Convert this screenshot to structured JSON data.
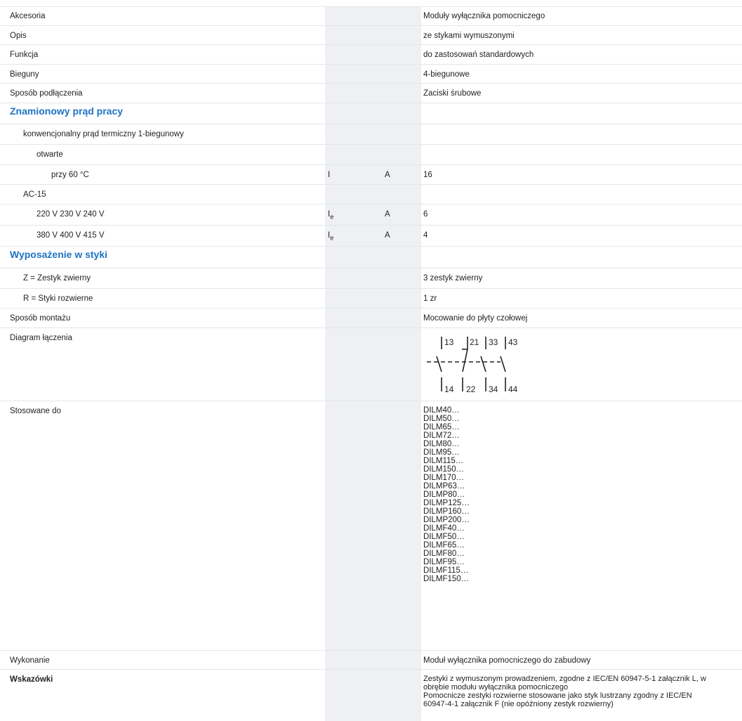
{
  "rows": [
    {
      "label": "Akcesoria",
      "value": "Moduły wyłącznika pomocniczego"
    },
    {
      "label": "Opis",
      "value": "ze stykami wymuszonymi"
    },
    {
      "label": "Funkcja",
      "value": "do zastosowań standardowych"
    },
    {
      "label": "Bieguny",
      "value": "4-biegunowe"
    },
    {
      "label": "Sposób podłączenia",
      "value": "Zaciski śrubowe"
    },
    {
      "heading": "Znamionowy prąd pracy"
    },
    {
      "label": "konwencjonalny prąd termiczny 1-biegunowy"
    },
    {
      "label": "otwarte"
    },
    {
      "label": "przy 60 °C",
      "symbol": "I",
      "unit": "A",
      "value": "16"
    },
    {
      "label": "AC-15"
    },
    {
      "label": "220 V 230 V 240 V",
      "symbol": "I",
      "symbol_sub": "e",
      "unit": "A",
      "value": "6"
    },
    {
      "label": "380 V 400 V 415 V",
      "symbol": "I",
      "symbol_sub": "e",
      "unit": "A",
      "value": "4"
    },
    {
      "heading": "Wyposażenie w styki"
    },
    {
      "label": "Z = Zestyk zwierny",
      "value": "3 zestyk zwierny"
    },
    {
      "label": "R = Styki rozwierne",
      "value": "1 zr"
    },
    {
      "label": "Sposób montażu",
      "value": "Mocowanie do płyty czołowej"
    },
    {
      "label": "Diagram łączenia"
    },
    {
      "label": "Stosowane do"
    },
    {
      "label": "Wykonanie",
      "value": "Moduł wyłącznika pomocniczego do zabudowy"
    },
    {
      "label": "Wskazówki",
      "value": "Zestyki z wymuszonym prowadzeniem, zgodne z IEC/EN 60947-5-1 załącznik L, w\nobrębie modułu wyłącznika pomocniczego\nPomocnicze zestyki rozwierne stosowane jako styk lustrzany zgodny z IEC/EN\n60947-4-1 załącznik F (nie opóźniony zestyk rozwierny)"
    }
  ],
  "diagram": {
    "terminals_top": [
      "13",
      "21",
      "33",
      "43"
    ],
    "terminals_bottom": [
      "14",
      "22",
      "34",
      "44"
    ]
  },
  "applicable_to": [
    "DILM40…",
    "DILM50…",
    "DILM65…",
    "DILM72…",
    "DILM80…",
    "DILM95…",
    "DILM115…",
    "DILM150…",
    "DILM170…",
    "DILMP63…",
    "DILMP80…",
    "DILMP125…",
    "DILMP160…",
    "DILMP200…",
    "DILMF40…",
    "DILMF50…",
    "DILMF65…",
    "DILMF80…",
    "DILMF95…",
    "DILMF115…",
    "DILMF150…"
  ]
}
